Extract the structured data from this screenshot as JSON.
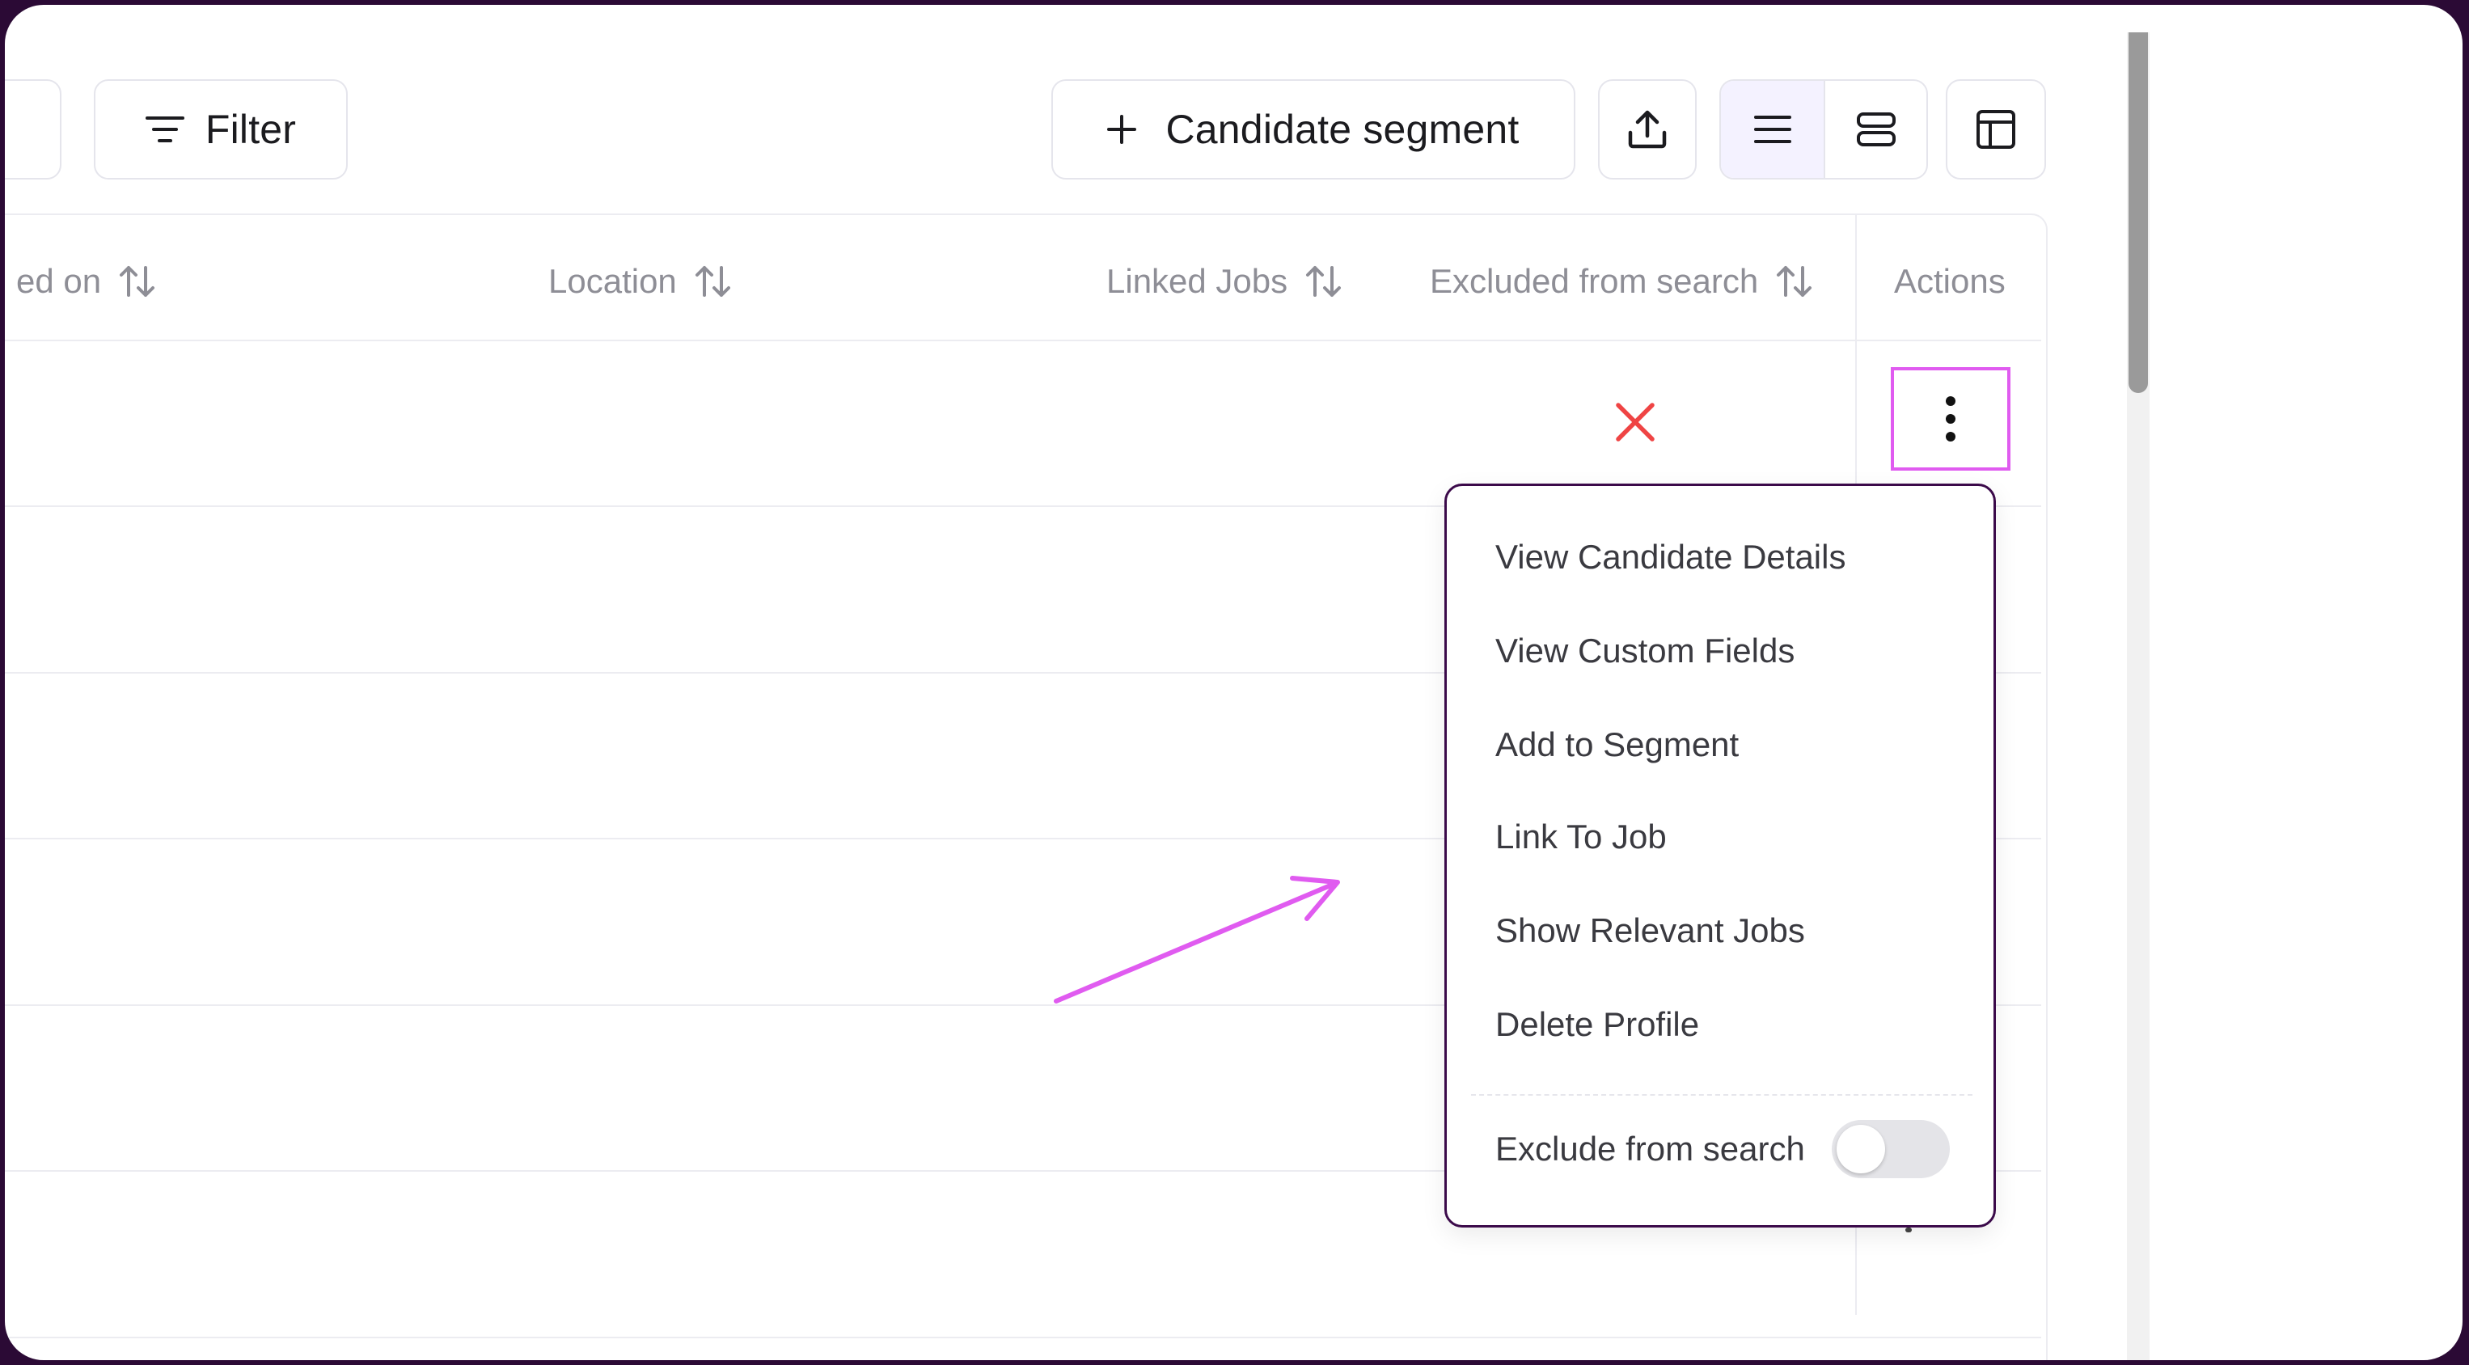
{
  "toolbar": {
    "filter_label": "Filter",
    "segment_label": "Candidate segment",
    "icons": {
      "filter": "filter-lines-icon",
      "add": "plus-icon",
      "export": "upload-icon",
      "list_view": "list-view-icon",
      "card_view": "card-view-icon",
      "columns": "table-columns-icon"
    }
  },
  "table": {
    "columns": [
      {
        "label": "ed on"
      },
      {
        "label": "Location"
      },
      {
        "label": "Linked Jobs"
      },
      {
        "label": "Excluded from search"
      },
      {
        "label": "Actions"
      }
    ],
    "rows": [
      {
        "excluded_icon": "x-icon"
      }
    ]
  },
  "menu": {
    "items": [
      {
        "label": "View Candidate Details"
      },
      {
        "label": "View Custom Fields"
      },
      {
        "label": "Add to Segment"
      },
      {
        "label": "Link To Job"
      },
      {
        "label": "Show Relevant Jobs"
      },
      {
        "label": "Delete Profile"
      }
    ],
    "toggle_label": "Exclude from search",
    "toggle_on": false
  },
  "colors": {
    "annotation": "#e05bf0",
    "excluded_x": "#ef4444",
    "menu_border": "#3b0a4a",
    "view_active_bg": "#f4f2ff"
  }
}
